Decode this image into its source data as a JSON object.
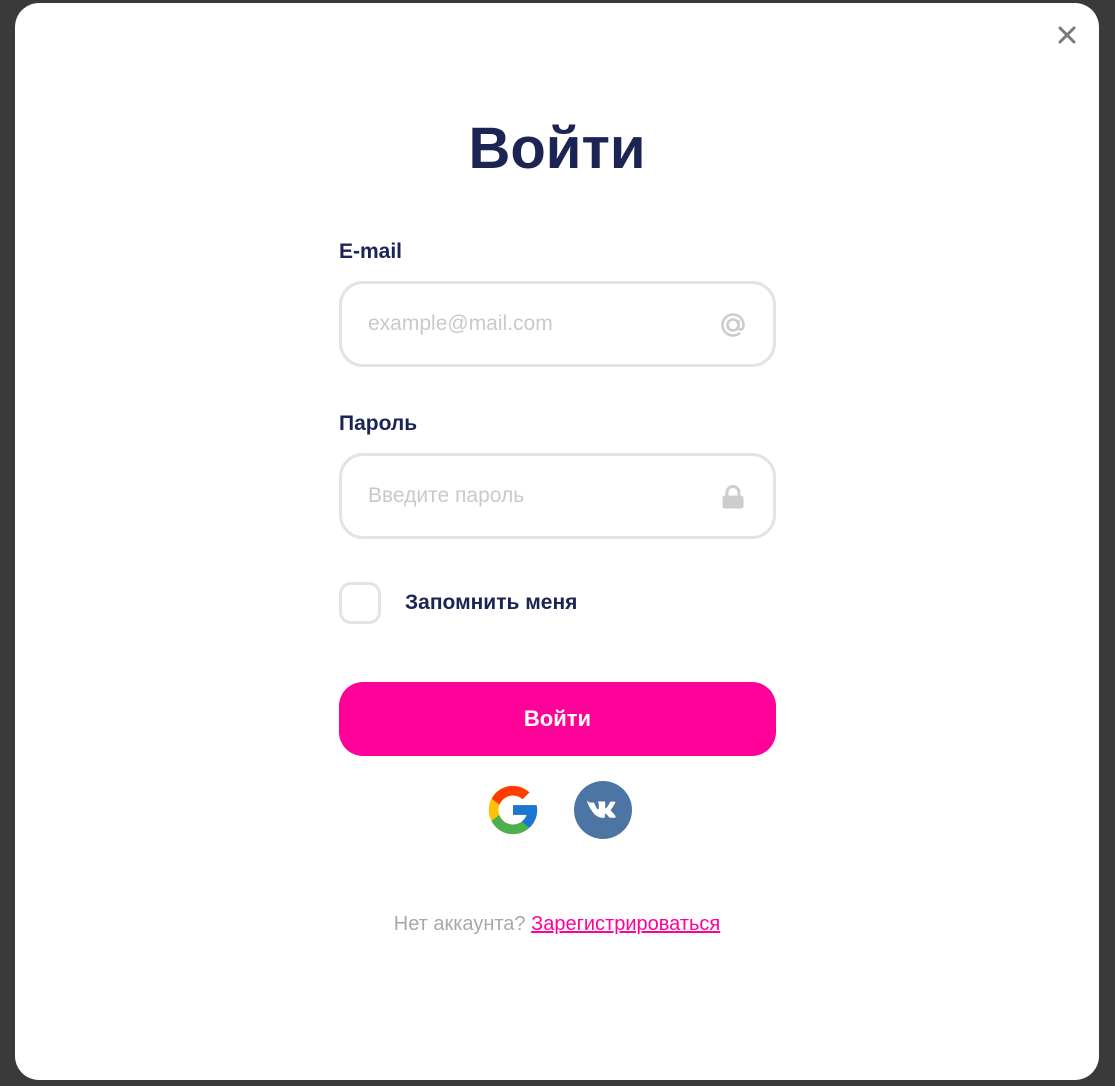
{
  "modal": {
    "title": "Войти",
    "close_icon": "close-icon"
  },
  "form": {
    "email": {
      "label": "E-mail",
      "placeholder": "example@mail.com",
      "value": "",
      "icon": "at-icon"
    },
    "password": {
      "label": "Пароль",
      "placeholder": "Введите пароль",
      "value": "",
      "icon": "lock-icon"
    },
    "remember": {
      "label": "Запомнить меня",
      "checked": false
    },
    "submit_label": "Войти"
  },
  "social": [
    {
      "name": "Google",
      "icon": "google-icon"
    },
    {
      "name": "VK",
      "icon": "vk-icon"
    }
  ],
  "footer": {
    "prompt": "Нет аккаунта?",
    "link": "Зарегистрироваться"
  },
  "colors": {
    "accent": "#ff0099",
    "heading": "#1b2453",
    "vk": "#4c75a3",
    "border": "#e3e3e3"
  }
}
